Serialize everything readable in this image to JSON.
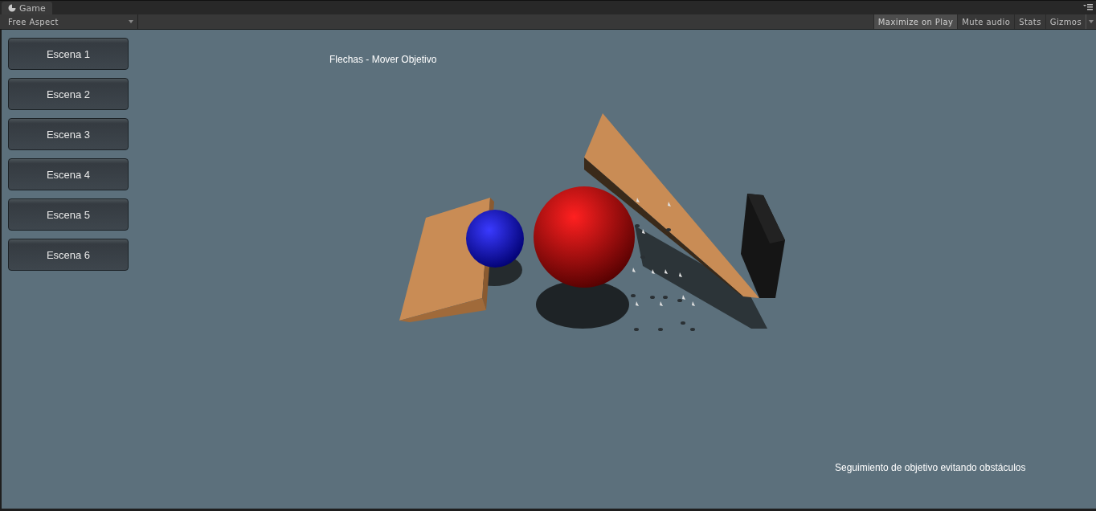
{
  "window": {
    "tab": "Game"
  },
  "toolbar": {
    "aspect": "Free Aspect",
    "toggles": [
      {
        "label": "Maximize on Play",
        "selected": true
      },
      {
        "label": "Mute audio",
        "selected": false
      },
      {
        "label": "Stats",
        "selected": false
      },
      {
        "label": "Gizmos",
        "selected": false
      }
    ]
  },
  "game": {
    "buttons": [
      "Escena 1",
      "Escena 2",
      "Escena 3",
      "Escena 4",
      "Escena 5",
      "Escena 6"
    ],
    "hint": "Flechas - Mover Objetivo",
    "caption": "Seguimiento de objetivo evitando obstáculos"
  }
}
